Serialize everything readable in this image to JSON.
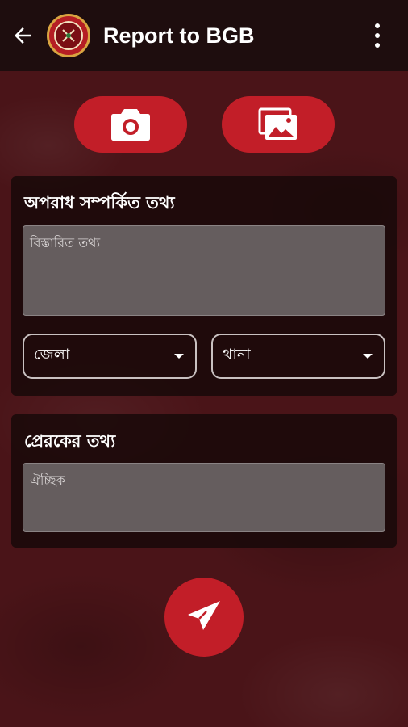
{
  "appbar": {
    "title": "Report to BGB",
    "back_icon": "arrow-left-icon",
    "logo_icon": "bgb-emblem-icon",
    "menu_icon": "more-vert-icon"
  },
  "media": {
    "camera_icon": "camera-icon",
    "gallery_icon": "gallery-icon"
  },
  "crime_info": {
    "title": "অপরাধ সম্পর্কিত তথ্য",
    "details_placeholder": "বিস্তারিত তথ্য",
    "district_label": "জেলা",
    "thana_label": "থানা"
  },
  "sender_info": {
    "title": "প্রেরকের তথ্য",
    "optional_placeholder": "ঐচ্ছিক"
  },
  "send": {
    "icon": "send-icon"
  },
  "colors": {
    "accent": "#c21e28",
    "appbar_bg": "#1e0d0e",
    "background": "#4a1418",
    "input_bg": "#655d5e"
  }
}
